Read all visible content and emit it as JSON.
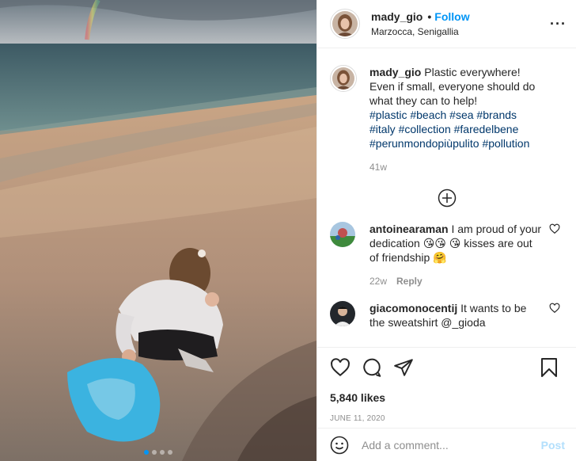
{
  "post": {
    "username": "mady_gio",
    "follow_label": "Follow",
    "location": "Marzocca, Senigallia",
    "caption_text": "Plastic everywhere! Even if small, everyone should do what they can to help!",
    "hashtags": "#plastic #beach #sea #brands #italy #collection #faredelbene #perunmondopiùpulito #pollution",
    "age": "41w",
    "likes": "5,840 likes",
    "date": "JUNE 11, 2020",
    "carousel_count": 4,
    "carousel_active": 1
  },
  "comments": [
    {
      "username": "antoinearaman",
      "text": "I am proud of your dedication 😘😘 😘 kisses are out of friendship 🤗",
      "age": "22w",
      "reply_label": "Reply"
    },
    {
      "username": "giacomonocentij",
      "text": "It wants to be the sweatshirt @_gioda"
    }
  ],
  "add_comment": {
    "placeholder": "Add a comment...",
    "post_label": "Post"
  },
  "icons": {
    "more": "more-options-icon",
    "load_more": "load-more-icon",
    "like": "heart-icon",
    "comment": "comment-icon",
    "share": "share-icon",
    "save": "bookmark-icon",
    "emoji": "emoji-icon"
  },
  "colors": {
    "link": "#0095f6",
    "hashtag": "#00376b",
    "muted": "#8e8e8e"
  }
}
